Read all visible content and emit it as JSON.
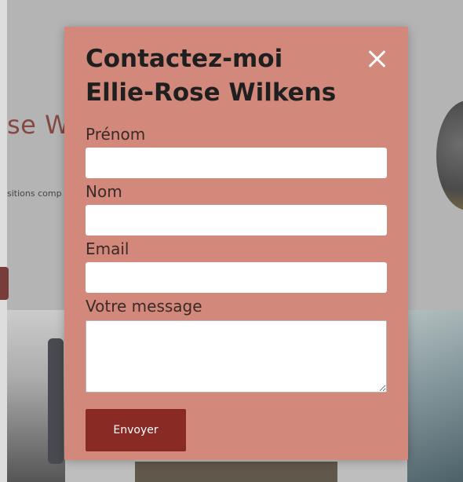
{
  "background": {
    "name_fragment": "se W",
    "tagline_fragment": "sitions comp"
  },
  "modal": {
    "title_line1": "Contactez-moi",
    "title_line2": "Ellie-Rose Wilkens",
    "close_icon": "close-icon",
    "fields": {
      "prenom": {
        "label": "Prénom",
        "value": ""
      },
      "nom": {
        "label": "Nom",
        "value": ""
      },
      "email": {
        "label": "Email",
        "value": ""
      },
      "message": {
        "label": "Votre message",
        "value": ""
      }
    },
    "submit_label": "Envoyer"
  },
  "colors": {
    "modal_bg": "#d2887a",
    "button_bg": "#8a2a24",
    "brand_text": "#8a3a32"
  }
}
